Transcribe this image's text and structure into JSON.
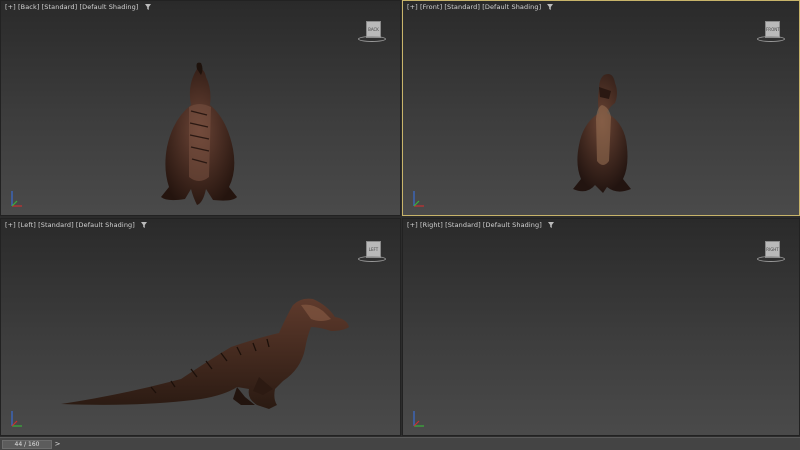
{
  "viewports": [
    {
      "plus": "[+]",
      "view": "[Back]",
      "mode": "[Standard]",
      "shading": "[Default Shading]",
      "cube": "BACK"
    },
    {
      "plus": "[+]",
      "view": "[Front]",
      "mode": "[Standard]",
      "shading": "[Default Shading]",
      "cube": "FRONT"
    },
    {
      "plus": "[+]",
      "view": "[Left]",
      "mode": "[Standard]",
      "shading": "[Default Shading]",
      "cube": "LEFT"
    },
    {
      "plus": "[+]",
      "view": "[Right]",
      "mode": "[Standard]",
      "shading": "[Default Shading]",
      "cube": "RIGHT"
    }
  ],
  "timeline": {
    "frame": "44 / 160",
    "next": ">"
  },
  "colors": {
    "active_border": "#c8b46a",
    "dino_body": "#4a2e24",
    "dino_dark": "#22150f",
    "dino_light": "#8a6a4a"
  }
}
